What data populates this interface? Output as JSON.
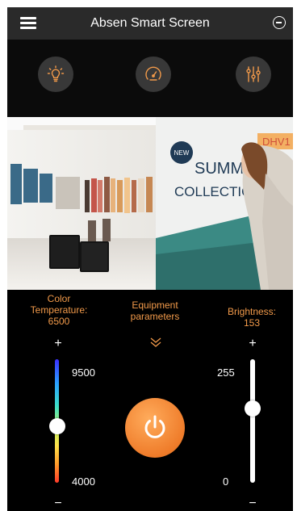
{
  "header": {
    "title": "Absen Smart Screen"
  },
  "icons": {
    "menu": "hamburger-icon",
    "collapse": "minus-circle-icon",
    "tabs": [
      "lightbulb-icon",
      "speedometer-icon",
      "sliders-icon"
    ],
    "power": "power-icon"
  },
  "banner": {
    "badge": "NEW",
    "line1": "SUMMER",
    "line2": "COLLECTION",
    "sign": "DHV1"
  },
  "controls": {
    "color_temperature": {
      "label": "Color Temperature:",
      "value": "6500",
      "max": "9500",
      "min": "4000",
      "level": 0.46
    },
    "equipment_label": "Equipment parameters",
    "brightness": {
      "label": "Brightness:",
      "value": "153",
      "max": "255",
      "min": "0",
      "level": 0.6
    },
    "plus": "+",
    "minus": "−"
  },
  "colors": {
    "accent": "#f29a4a",
    "power": "#ef7c2a",
    "header": "#2a2a2a"
  }
}
